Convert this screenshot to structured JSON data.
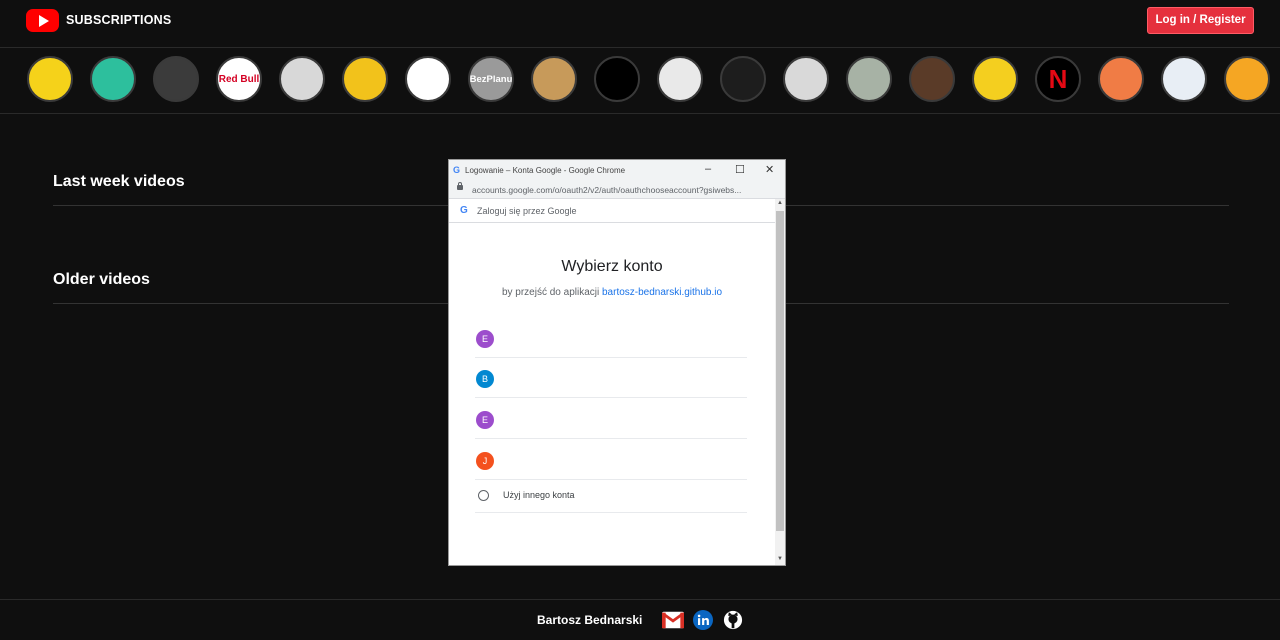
{
  "header": {
    "brand": "SUBSCRIPTIONS",
    "login_label": "Log in / Register",
    "logo_icon": "youtube-play-icon",
    "accent": "#e5303d"
  },
  "channels": [
    {
      "name": "channel-1",
      "label": "",
      "bg": "#f5d21a"
    },
    {
      "name": "channel-2",
      "label": "",
      "bg": "#2dbf9d"
    },
    {
      "name": "channel-3",
      "label": "",
      "bg": "#3b3b3b"
    },
    {
      "name": "channel-4",
      "label": "Red Bull",
      "bg": "#ffffff"
    },
    {
      "name": "channel-5",
      "label": "",
      "bg": "#d8d8d8"
    },
    {
      "name": "channel-6",
      "label": "",
      "bg": "#f2c21b"
    },
    {
      "name": "channel-7",
      "label": "",
      "bg": "#ffffff"
    },
    {
      "name": "channel-8",
      "label": "BezPlanu",
      "bg": "#9a9a9a"
    },
    {
      "name": "channel-9",
      "label": "",
      "bg": "#c79a5a"
    },
    {
      "name": "channel-10",
      "label": "",
      "bg": "#000000"
    },
    {
      "name": "channel-11",
      "label": "",
      "bg": "#e9e9e9"
    },
    {
      "name": "channel-12",
      "label": "",
      "bg": "#1d1d1d"
    },
    {
      "name": "channel-13",
      "label": "",
      "bg": "#d9d9d9"
    },
    {
      "name": "channel-14",
      "label": "",
      "bg": "#a7b2a5"
    },
    {
      "name": "channel-15",
      "label": "",
      "bg": "#5a3b28"
    },
    {
      "name": "channel-16",
      "label": "",
      "bg": "#f4cf1f"
    },
    {
      "name": "channel-17",
      "label": "N",
      "bg": "#000000"
    },
    {
      "name": "channel-18",
      "label": "",
      "bg": "#f07c45"
    },
    {
      "name": "channel-19",
      "label": "",
      "bg": "#e8eef5"
    },
    {
      "name": "channel-20",
      "label": "",
      "bg": "#f5a623"
    }
  ],
  "sections": {
    "last_week": "Last week videos",
    "older": "Older videos"
  },
  "popup": {
    "window_title": "Logowanie – Konta Google - Google Chrome",
    "url": "accounts.google.com/o/oauth2/v2/auth/oauthchooseaccount?gsiwebs...",
    "signin_bar": "Zaloguj się przez Google",
    "title": "Wybierz konto",
    "subtitle_prefix": "by przejść do aplikacji ",
    "subtitle_link": "bartosz-bednarski.github.io",
    "accounts": [
      {
        "initial": "E",
        "color": "#9c4dcc"
      },
      {
        "initial": "B",
        "color": "#0288d1"
      },
      {
        "initial": "E",
        "color": "#9c4dcc"
      },
      {
        "initial": "J",
        "color": "#f4511e"
      }
    ],
    "other_account": "Użyj innego konta"
  },
  "footer": {
    "name": "Bartosz Bednarski",
    "icons": [
      "gmail-icon",
      "linkedin-icon",
      "github-icon"
    ]
  }
}
